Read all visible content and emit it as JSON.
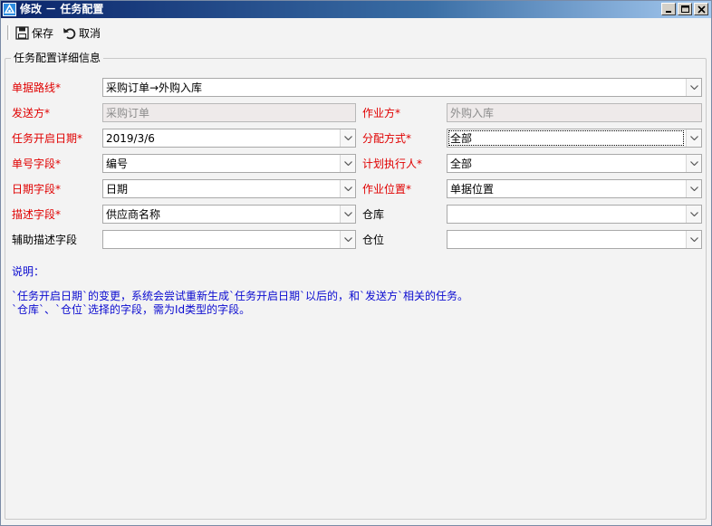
{
  "window": {
    "title": "修改 － 任务配置",
    "controls": {
      "minimize": "minimize",
      "maximize": "maximize",
      "close": "close"
    }
  },
  "toolbar": {
    "save_label": "保存",
    "cancel_label": "取消"
  },
  "group": {
    "legend": "任务配置详细信息"
  },
  "form": {
    "route_label": "单据路线*",
    "route_value": "采购订单→外购入库",
    "sender_label": "发送方*",
    "sender_value": "采购订单",
    "operator_label": "作业方*",
    "operator_value": "外购入库",
    "start_date_label": "任务开启日期*",
    "start_date_value": "2019/3/6",
    "assign_label": "分配方式*",
    "assign_value": "全部",
    "number_field_label": "单号字段*",
    "number_field_value": "编号",
    "planner_label": "计划执行人*",
    "planner_value": "全部",
    "date_field_label": "日期字段*",
    "date_field_value": "日期",
    "location_label": "作业位置*",
    "location_value": "单据位置",
    "desc_field_label": "描述字段*",
    "desc_field_value": "供应商名称",
    "warehouse_label": "仓库",
    "warehouse_value": "",
    "aux_desc_label": "辅助描述字段",
    "aux_desc_value": "",
    "bin_label": "仓位",
    "bin_value": ""
  },
  "notes": {
    "heading": "说明：",
    "line1": "`任务开启日期`的变更，系统会尝试重新生成`任务开启日期`以后的，和`发送方`相关的任务。",
    "line2": "`仓库`、`仓位`选择的字段，需为Id类型的字段。"
  },
  "colors": {
    "required_label": "#e00000",
    "note_text": "#0b0bd0",
    "titlebar_start": "#0a246a",
    "titlebar_end": "#a6caf0"
  }
}
